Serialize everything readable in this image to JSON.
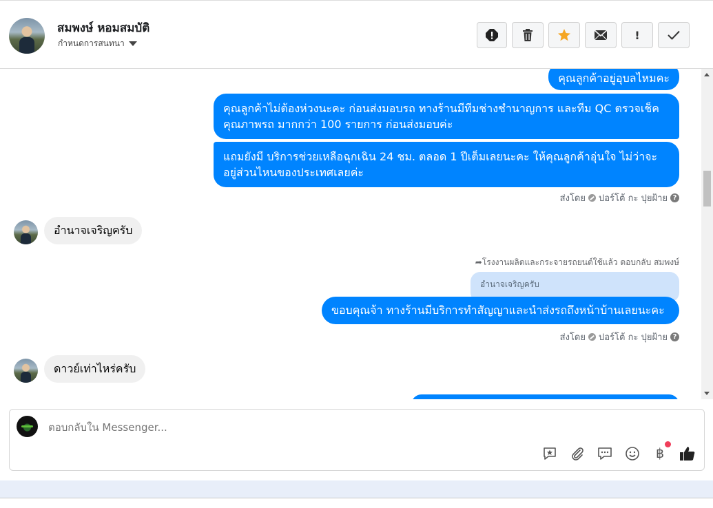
{
  "header": {
    "contact_name": "สมพงษ์ หอมสมบัติ",
    "assign_label": "กำหนดการสนทนา",
    "toolbar": {
      "spam_icon": "alert-circle-icon",
      "delete_icon": "trash-icon",
      "star_icon": "star-icon",
      "unread_icon": "envelope-icon",
      "follow_up_label": "!",
      "done_icon": "check-icon"
    }
  },
  "messages": {
    "m1": "คุณลูกค้าอยู่อุบลไหมคะ",
    "m2": "คุณลูกค้าไม่ต้องห่วงนะคะ ก่อนส่งมอบรถ ทางร้านมีทีมช่างชำนาญการ และทีม QC ตรวจเช็คคุณภาพรถ มากกว่า 100 รายการ ก่อนส่งมอบค่ะ",
    "m3": "แถมยังมี บริการช่วยเหลือฉุกเฉิน 24 ชม. ตลอด 1 ปีเต็มเลยนะคะ ให้คุณลูกค้าอุ่นใจ ไม่ว่าจะอยู่ส่วนไหนของประเทศเลยค่ะ",
    "sent_by_1": "ส่งโดย",
    "sender_1": "ปอร์โต้ กะ ปุยฝ้าย",
    "in1": "อำนาจเจริญครับ",
    "reply_meta": "โรงงานผลิตและกระจายรถยนต์ใช้แล้ว ตอบกลับ สมพงษ์",
    "quoted_text": "อำนาจเจริญครับ",
    "m4": "ขอบคุณจ้า ทางร้านมีบริการทำสัญญาและนำส่งรถถึงหน้าบ้านเลยนะคะ",
    "sent_by_2": "ส่งโดย",
    "sender_2": "ปอร์โต้ กะ ปุยฝ้าย",
    "in2": "ดาวย์เท่าไหร่ครับ",
    "help_mark": "?"
  },
  "composer": {
    "placeholder": "ตอบกลับใน Messenger...",
    "baht_symbol": "฿",
    "tools": [
      "saved-reply-icon",
      "attachment-icon",
      "chat-bubble-icon",
      "emoji-icon",
      "baht-icon",
      "thumbs-up-icon"
    ]
  },
  "colors": {
    "outgoing_bubble": "#0084ff",
    "incoming_bubble": "#f0f0f0",
    "quoted_bubble": "#cfe3fb",
    "star": "#f5a623"
  }
}
